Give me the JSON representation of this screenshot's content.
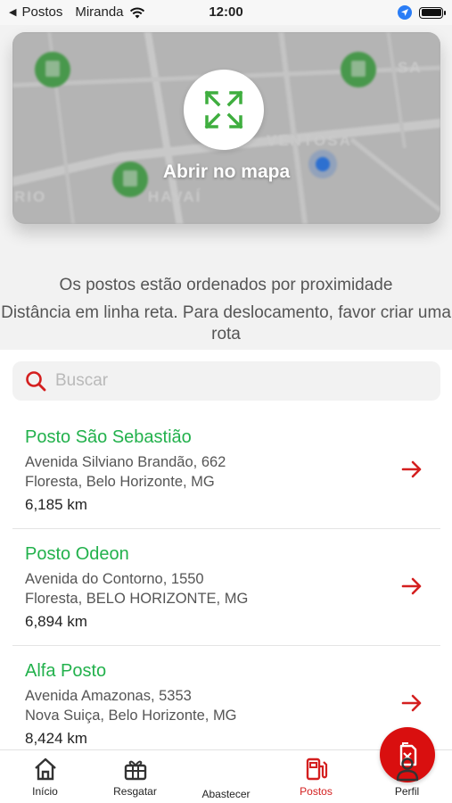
{
  "status_bar": {
    "back_app": "Postos",
    "carrier": "Miranda",
    "time": "12:00"
  },
  "map": {
    "open_label": "Abrir no mapa",
    "street_labels": [
      "VENTOSA",
      "HAVAÍ",
      "SA",
      "RIO"
    ]
  },
  "info": {
    "line1": "Os postos estão ordenados por proximidade",
    "line2": "Distância em linha reta. Para deslocamento, favor criar uma rota"
  },
  "search": {
    "placeholder": "Buscar",
    "value": ""
  },
  "stations": [
    {
      "name": "Posto São Sebastião",
      "street": "Avenida Silviano Brandão, 662",
      "locality": "Floresta, Belo Horizonte, MG",
      "distance": "6,185 km"
    },
    {
      "name": "Posto Odeon",
      "street": "Avenida do Contorno, 1550",
      "locality": "Floresta, BELO HORIZONTE, MG",
      "distance": "6,894 km"
    },
    {
      "name": "Alfa Posto",
      "street": "Avenida Amazonas, 5353",
      "locality": "Nova Suiça, Belo Horizonte, MG",
      "distance": "8,424 km"
    }
  ],
  "tabbar": {
    "items": [
      {
        "label": "Início",
        "icon": "home-icon"
      },
      {
        "label": "Resgatar",
        "icon": "gift-icon"
      },
      {
        "label": "Abastecer",
        "icon": "fuel-can-icon"
      },
      {
        "label": "Postos",
        "icon": "gas-station-icon"
      },
      {
        "label": "Perfil",
        "icon": "person-icon"
      }
    ],
    "active": "Postos"
  },
  "colors": {
    "accent_red": "#d41f1f",
    "station_green": "#22b14c",
    "map_marker_green": "#4caf50",
    "location_blue": "#2a7df6"
  }
}
